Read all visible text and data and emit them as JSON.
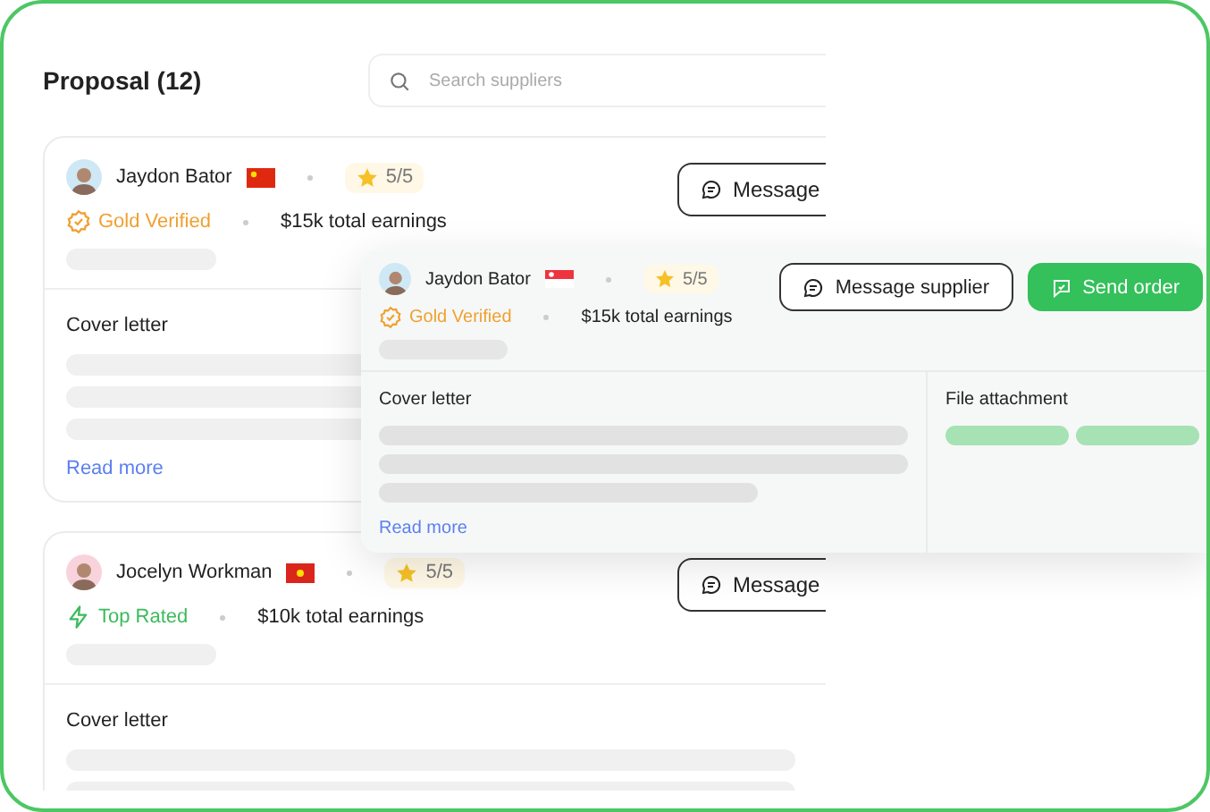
{
  "header": {
    "title": "Proposal (12)",
    "search": {
      "placeholder": "Search suppliers"
    }
  },
  "proposals": [
    {
      "name": "Jaydon Bator",
      "avatar": {
        "color": "#cfe8f5"
      },
      "flag": {
        "kind": "cn"
      },
      "rating": "5/5",
      "badge": {
        "kind": "gold",
        "label": "Gold Verified"
      },
      "earnings": "$15k total earnings",
      "button": "Message",
      "cover_title": "Cover letter",
      "link": "Read more"
    },
    {
      "name": "Jocelyn Workman",
      "avatar": {
        "color": "#f8d3dc"
      },
      "flag": {
        "kind": "vn"
      },
      "rating": "5/5",
      "badge": {
        "kind": "top",
        "label": "Top Rated"
      },
      "earnings": "$10k total earnings",
      "button": "Message",
      "cover_title": "Cover letter"
    }
  ],
  "detail": {
    "name": "Jaydon Bator",
    "avatar": {
      "color": "#cfe8f5"
    },
    "flag": {
      "kind": "sg"
    },
    "rating": "5/5",
    "badge": {
      "kind": "gold",
      "label": "Gold Verified"
    },
    "earnings": "$15k total earnings",
    "buttons": [
      {
        "kind": "outline",
        "label": "Message supplier"
      },
      {
        "kind": "primary",
        "label": "Send order"
      }
    ],
    "cover_title": "Cover letter",
    "link": "Read more",
    "attachment_title": "File attachment"
  }
}
